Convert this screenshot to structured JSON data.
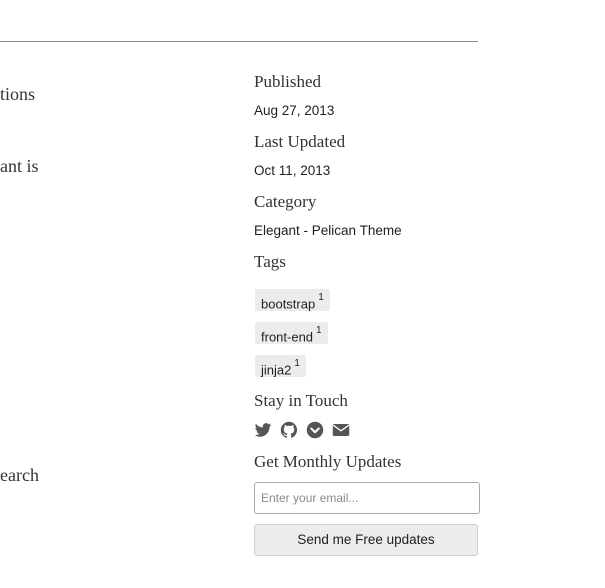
{
  "main": {
    "fragments": [
      "tions",
      "ant is",
      "earch"
    ]
  },
  "sidebar": {
    "published": {
      "heading": "Published",
      "value": "Aug 27, 2013"
    },
    "last_updated": {
      "heading": "Last Updated",
      "value": "Oct 11, 2013"
    },
    "category": {
      "heading": "Category",
      "value": "Elegant - Pelican Theme"
    },
    "tags": {
      "heading": "Tags",
      "items": [
        {
          "label": "bootstrap",
          "count": "1"
        },
        {
          "label": "front-end",
          "count": "1"
        },
        {
          "label": "jinja2",
          "count": "1"
        }
      ]
    },
    "stay_in_touch": {
      "heading": "Stay in Touch",
      "icons": [
        "twitter-icon",
        "github-icon",
        "pocket-icon",
        "email-icon"
      ],
      "icon_color": "#555555"
    },
    "monthly_updates": {
      "heading": "Get Monthly Updates",
      "email_placeholder": "Enter your email...",
      "button_label": "Send me Free updates"
    }
  }
}
